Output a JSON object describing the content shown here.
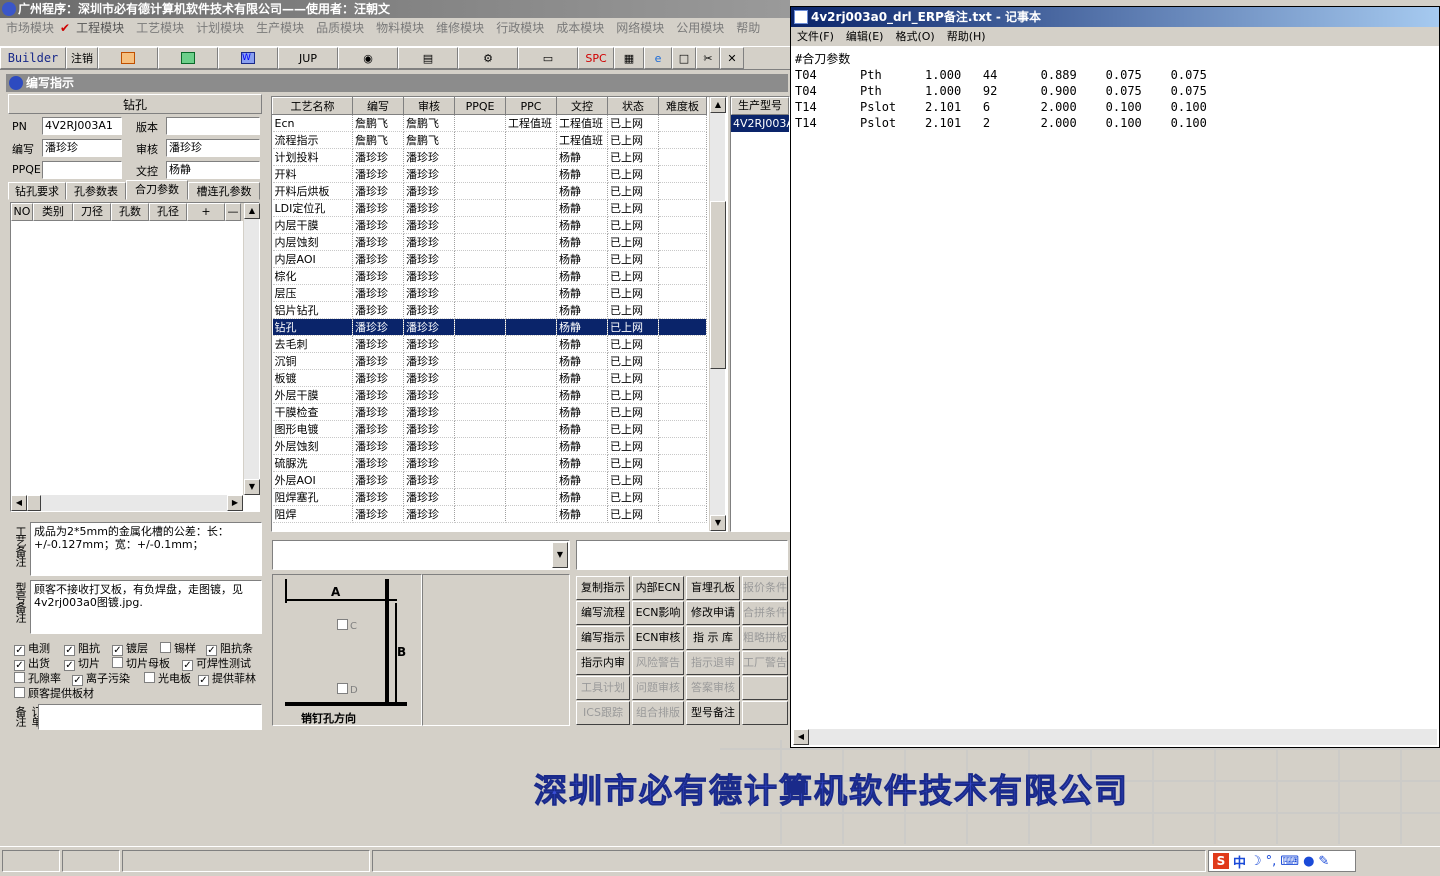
{
  "app": {
    "title": "广州程序：深圳市必有德计算机软件技术有限公司——使用者：汪朝文",
    "company_banner": "深圳市必有德计算机软件技术有限公司"
  },
  "menu": [
    "市场模块",
    "工程模块",
    "工艺模块",
    "计划模块",
    "生产模块",
    "品质模块",
    "物料模块",
    "维修模块",
    "行政模块",
    "成本模块",
    "网络模块",
    "公用模块",
    "帮助"
  ],
  "toolbar": {
    "builder": "Builder",
    "logout": "注销",
    "jup": "JUP",
    "spc": "SPC"
  },
  "window": {
    "title": "编写指示"
  },
  "info": {
    "heading": "钻孔",
    "pn_label": "PN",
    "pn_value": "4V2RJ003A1",
    "version_label": "版本",
    "version_value": "",
    "author_label": "编写",
    "author_value": "潘珍珍",
    "review_label": "审核",
    "review_value": "潘珍珍",
    "ppqe_label": "PPQE",
    "ppqe_value": "",
    "doc_label": "文控",
    "doc_value": "杨静"
  },
  "tabs": [
    "钻孔要求",
    "孔参数表",
    "合刀参数",
    "槽连孔参数"
  ],
  "subgrid": {
    "headers": [
      "NO",
      "类别",
      "刀径",
      "孔数",
      "孔径",
      "+",
      "—"
    ]
  },
  "remarks": {
    "process_label": "工艺备注",
    "process_text": "成品为2*5mm的金属化槽的公差：长：+/-0.127mm；宽：+/-0.1mm；",
    "model_label": "型号备注",
    "model_text": "顾客不接收打叉板，有负焊盘，走图镀，见4v2rj003a0图镀.jpg.",
    "order_label": "订单备注"
  },
  "checks": [
    {
      "label": "电测",
      "checked": true
    },
    {
      "label": "阻抗",
      "checked": true
    },
    {
      "label": "镀层",
      "checked": true
    },
    {
      "label": "锡样",
      "checked": false
    },
    {
      "label": "阻抗条",
      "checked": true
    },
    {
      "label": "出货",
      "checked": true
    },
    {
      "label": "切片",
      "checked": true
    },
    {
      "label": "切片母板",
      "checked": false
    },
    {
      "label": "可焊性测试",
      "checked": true
    },
    {
      "label": "孔隙率",
      "checked": false
    },
    {
      "label": "离子污染",
      "checked": true
    },
    {
      "label": "光电板",
      "checked": false
    },
    {
      "label": "提供菲林",
      "checked": true
    },
    {
      "label": "顾客提供板材",
      "checked": false
    }
  ],
  "process": {
    "headers": [
      "工艺名称",
      "编写",
      "审核",
      "PPQE",
      "PPC",
      "文控",
      "状态",
      "难度板"
    ],
    "rows": [
      [
        "Ecn",
        "詹鹏飞",
        "詹鹏飞",
        "",
        "工程值班",
        "工程值班",
        "已上网",
        ""
      ],
      [
        "流程指示",
        "詹鹏飞",
        "詹鹏飞",
        "",
        "",
        "工程值班",
        "已上网",
        ""
      ],
      [
        "计划投料",
        "潘珍珍",
        "潘珍珍",
        "",
        "",
        "杨静",
        "已上网",
        ""
      ],
      [
        "开料",
        "潘珍珍",
        "潘珍珍",
        "",
        "",
        "杨静",
        "已上网",
        ""
      ],
      [
        "开料后烘板",
        "潘珍珍",
        "潘珍珍",
        "",
        "",
        "杨静",
        "已上网",
        ""
      ],
      [
        "LDI定位孔",
        "潘珍珍",
        "潘珍珍",
        "",
        "",
        "杨静",
        "已上网",
        ""
      ],
      [
        "内层干膜",
        "潘珍珍",
        "潘珍珍",
        "",
        "",
        "杨静",
        "已上网",
        ""
      ],
      [
        "内层蚀刻",
        "潘珍珍",
        "潘珍珍",
        "",
        "",
        "杨静",
        "已上网",
        ""
      ],
      [
        "内层AOI",
        "潘珍珍",
        "潘珍珍",
        "",
        "",
        "杨静",
        "已上网",
        ""
      ],
      [
        "棕化",
        "潘珍珍",
        "潘珍珍",
        "",
        "",
        "杨静",
        "已上网",
        ""
      ],
      [
        "层压",
        "潘珍珍",
        "潘珍珍",
        "",
        "",
        "杨静",
        "已上网",
        ""
      ],
      [
        "铝片钻孔",
        "潘珍珍",
        "潘珍珍",
        "",
        "",
        "杨静",
        "已上网",
        ""
      ],
      [
        "钻孔",
        "潘珍珍",
        "潘珍珍",
        "",
        "",
        "杨静",
        "已上网",
        ""
      ],
      [
        "去毛刺",
        "潘珍珍",
        "潘珍珍",
        "",
        "",
        "杨静",
        "已上网",
        ""
      ],
      [
        "沉铜",
        "潘珍珍",
        "潘珍珍",
        "",
        "",
        "杨静",
        "已上网",
        ""
      ],
      [
        "板镀",
        "潘珍珍",
        "潘珍珍",
        "",
        "",
        "杨静",
        "已上网",
        ""
      ],
      [
        "外层干膜",
        "潘珍珍",
        "潘珍珍",
        "",
        "",
        "杨静",
        "已上网",
        ""
      ],
      [
        "干膜检查",
        "潘珍珍",
        "潘珍珍",
        "",
        "",
        "杨静",
        "已上网",
        ""
      ],
      [
        "图形电镀",
        "潘珍珍",
        "潘珍珍",
        "",
        "",
        "杨静",
        "已上网",
        ""
      ],
      [
        "外层蚀刻",
        "潘珍珍",
        "潘珍珍",
        "",
        "",
        "杨静",
        "已上网",
        ""
      ],
      [
        "硫脲洗",
        "潘珍珍",
        "潘珍珍",
        "",
        "",
        "杨静",
        "已上网",
        ""
      ],
      [
        "外层AOI",
        "潘珍珍",
        "潘珍珍",
        "",
        "",
        "杨静",
        "已上网",
        ""
      ],
      [
        "阻焊塞孔",
        "潘珍珍",
        "潘珍珍",
        "",
        "",
        "杨静",
        "已上网",
        ""
      ],
      [
        "阻焊",
        "潘珍珍",
        "潘珍珍",
        "",
        "",
        "杨静",
        "已上网",
        ""
      ]
    ],
    "selected_index": 12
  },
  "model_list": {
    "header": "生产型号",
    "items": [
      "4V2RJ003A"
    ]
  },
  "diagram": {
    "a": "A",
    "b": "B",
    "c": "C",
    "d": "D",
    "caption": "销钉孔方向"
  },
  "buttons": [
    {
      "label": "复制指示",
      "enabled": true
    },
    {
      "label": "内部ECN",
      "enabled": true
    },
    {
      "label": "盲埋孔板",
      "enabled": true
    },
    {
      "label": "报价条件",
      "enabled": false
    },
    {
      "label": "编写流程",
      "enabled": true
    },
    {
      "label": "ECN影响",
      "enabled": true
    },
    {
      "label": "修改申请",
      "enabled": true
    },
    {
      "label": "合拼条件",
      "enabled": false
    },
    {
      "label": "编写指示",
      "enabled": true
    },
    {
      "label": "ECN审核",
      "enabled": true
    },
    {
      "label": "指 示 库",
      "enabled": true
    },
    {
      "label": "粗略拼板",
      "enabled": false
    },
    {
      "label": "指示内审",
      "enabled": true
    },
    {
      "label": "风险警告",
      "enabled": false
    },
    {
      "label": "指示退审",
      "enabled": false
    },
    {
      "label": "工厂警告",
      "enabled": false
    },
    {
      "label": "工具计划",
      "enabled": false
    },
    {
      "label": "问题审核",
      "enabled": false
    },
    {
      "label": "答案审核",
      "enabled": false
    },
    {
      "label": "",
      "enabled": false
    },
    {
      "label": "ICS跟踪",
      "enabled": false
    },
    {
      "label": "组合排版",
      "enabled": false
    },
    {
      "label": "型号备注",
      "enabled": true
    },
    {
      "label": "",
      "enabled": false
    }
  ],
  "notepad": {
    "title": "4v2rj003a0_drl_ERP备注.txt - 记事本",
    "menu": [
      "文件(F)",
      "编辑(E)",
      "格式(O)",
      "帮助(H)"
    ],
    "lines": [
      "#合刀参数",
      "T04      Pth      1.000   44      0.889    0.075    0.075",
      "T04      Pth      1.000   92      0.900    0.075    0.075",
      "T14      Pslot    2.101   6       2.000    0.100    0.100",
      "T14      Pslot    2.101   2       2.000    0.100    0.100"
    ]
  },
  "tray": {
    "ime": "中"
  }
}
